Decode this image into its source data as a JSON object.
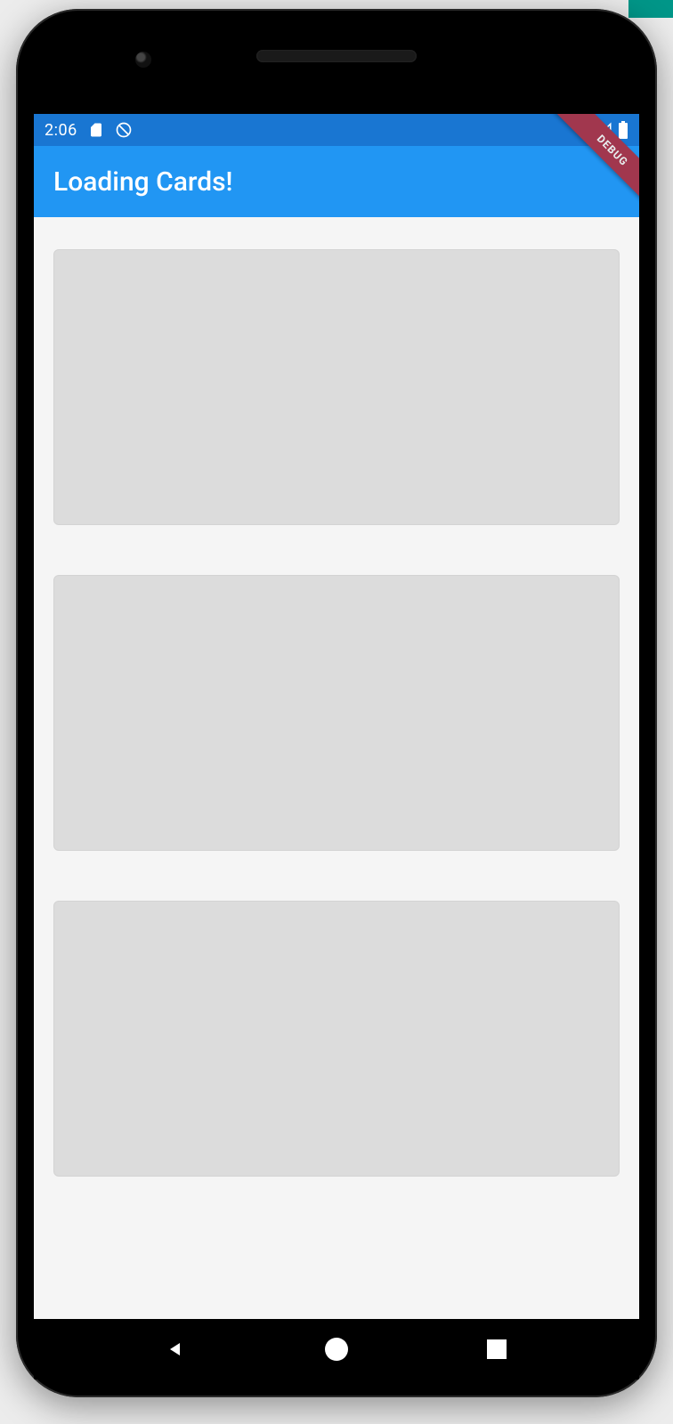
{
  "statusbar": {
    "time": "2:06",
    "sd_icon": "sd-card-icon",
    "dnd_icon": "dnd-icon",
    "wifi_icon": "wifi-icon",
    "cell_icon": "cell-signal-icon",
    "battery_icon": "battery-icon"
  },
  "appbar": {
    "title": "Loading Cards!",
    "debug_label": "DEBUG"
  },
  "cards": [
    {
      "state": "loading"
    },
    {
      "state": "loading"
    },
    {
      "state": "loading"
    }
  ],
  "navbar": {
    "back": "back",
    "home": "home",
    "recent": "recent"
  },
  "colors": {
    "status_bg": "#1976d2",
    "appbar_bg": "#2196f3",
    "card_bg": "#dcdcdc",
    "debug_bg": "#a1374e"
  }
}
